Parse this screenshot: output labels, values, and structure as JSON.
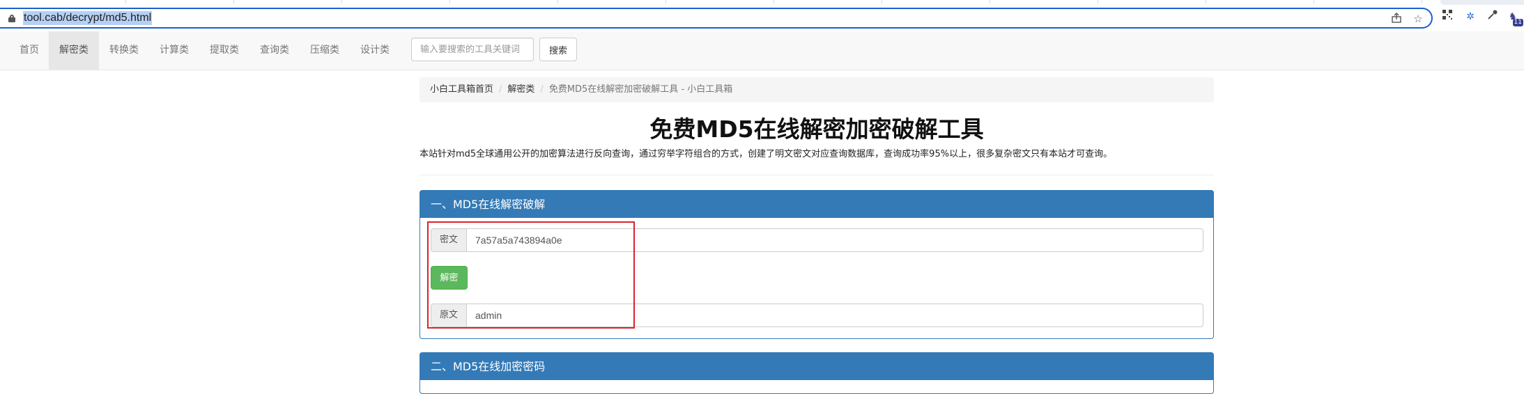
{
  "browser": {
    "url": "tool.cab/decrypt/md5.html",
    "extension_badge": "11"
  },
  "nav": {
    "items": [
      "首页",
      "解密类",
      "转换类",
      "计算类",
      "提取类",
      "查询类",
      "压缩类",
      "设计类"
    ],
    "active": "解密类",
    "search_placeholder": "输入要搜索的工具关键词",
    "search_button": "搜索"
  },
  "breadcrumb": {
    "home": "小白工具箱首页",
    "category": "解密类",
    "current": "免费MD5在线解密加密破解工具 - 小白工具箱"
  },
  "page": {
    "title": "免费MD5在线解密加密破解工具",
    "lead": "本站针对md5全球通用公开的加密算法进行反向查询，通过穷举字符组合的方式，创建了明文密文对应查询数据库，查询成功率95%以上，很多复杂密文只有本站才可查询。"
  },
  "panel1": {
    "heading": "一、MD5在线解密破解",
    "cipher_label": "密文",
    "cipher_value": "7a57a5a743894a0e",
    "decrypt_button": "解密",
    "plain_label": "原文",
    "plain_value": "admin"
  },
  "panel2": {
    "heading": "二、MD5在线加密密码"
  },
  "colors": {
    "primary": "#337ab7",
    "success": "#5cb85c",
    "highlight": "#d9232d",
    "address_focus": "#1a5fd0"
  },
  "icons": [
    "lock-icon",
    "share-icon",
    "star-icon",
    "qr-icon",
    "extension-gear-icon",
    "dropper-icon",
    "puzzle-icon"
  ]
}
